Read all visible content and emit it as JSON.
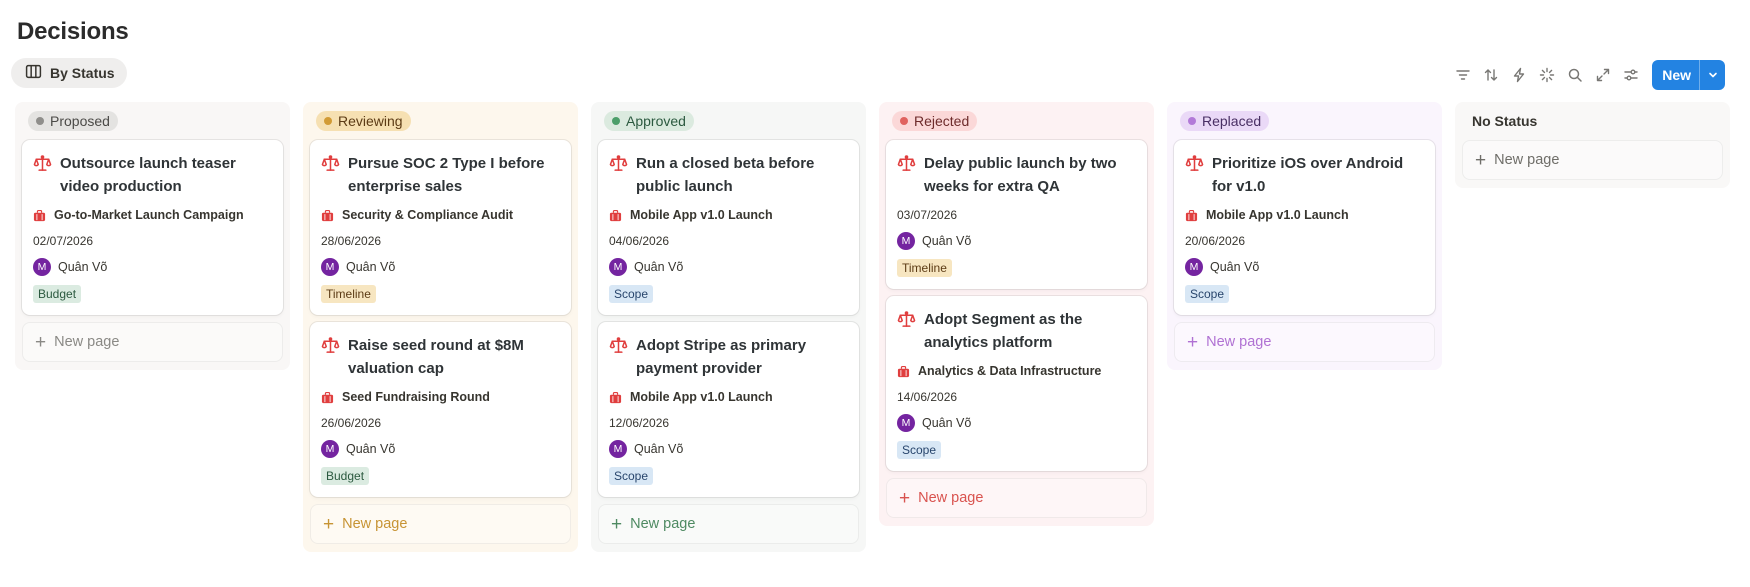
{
  "page": {
    "title": "Decisions"
  },
  "view": {
    "label": "By Status",
    "icon": "board-columns-icon"
  },
  "toolbar": {
    "icons": [
      "filter-icon",
      "sort-icon",
      "automation-lightning-icon",
      "ai-sparkle-icon",
      "search-icon",
      "expand-icon",
      "settings-sliders-icon"
    ],
    "new_label": "New"
  },
  "colors": {
    "accent": "#2383e2",
    "avatar": "#7424a0",
    "decision_icon": "#e03e3e"
  },
  "columns": [
    {
      "key": "proposed",
      "label": "Proposed",
      "bg": "#f9f7f6",
      "pill_bg": "#e4e3e1",
      "pill_text": "#4b4a47",
      "dot": "#8f8e8b",
      "new_page_color": "#8a8985",
      "new_page_label": "New page",
      "cards": [
        {
          "title": "Outsource launch teaser video production",
          "project": "Go-to-Market Launch Campaign",
          "date": "02/07/2026",
          "person": "Quân Võ",
          "avatar": "M",
          "tag": "Budget",
          "tag_bg": "#dbebe1",
          "tag_color": "#2b593f"
        }
      ]
    },
    {
      "key": "reviewing",
      "label": "Reviewing",
      "bg": "#fdf7ed",
      "pill_bg": "#f6e0b2",
      "pill_text": "#5c3b15",
      "dot": "#d29b35",
      "new_page_color": "#c79434",
      "new_page_label": "New page",
      "cards": [
        {
          "title": "Pursue SOC 2 Type I before enterprise sales",
          "project": "Security & Compliance Audit",
          "date": "28/06/2026",
          "person": "Quân Võ",
          "avatar": "M",
          "tag": "Timeline",
          "tag_bg": "#f7e6c1",
          "tag_color": "#5c3b15"
        },
        {
          "title": "Raise seed round at $8M valuation cap",
          "project": "Seed Fundraising Round",
          "date": "26/06/2026",
          "person": "Quân Võ",
          "avatar": "M",
          "tag": "Budget",
          "tag_bg": "#dbebe1",
          "tag_color": "#2b593f"
        }
      ]
    },
    {
      "key": "approved",
      "label": "Approved",
      "bg": "#f6f7f6",
      "pill_bg": "#dbeadf",
      "pill_text": "#2b593f",
      "dot": "#4b9e69",
      "new_page_color": "#4e8a62",
      "new_page_label": "New page",
      "cards": [
        {
          "title": "Run a closed beta before public launch",
          "project": "Mobile App v1.0 Launch",
          "date": "04/06/2026",
          "person": "Quân Võ",
          "avatar": "M",
          "tag": "Scope",
          "tag_bg": "#d8e7f5",
          "tag_color": "#28456c"
        },
        {
          "title": "Adopt Stripe as primary payment provider",
          "project": "Mobile App v1.0 Launch",
          "date": "12/06/2026",
          "person": "Quân Võ",
          "avatar": "M",
          "tag": "Scope",
          "tag_bg": "#d8e7f5",
          "tag_color": "#28456c"
        }
      ]
    },
    {
      "key": "rejected",
      "label": "Rejected",
      "bg": "#fdf2f3",
      "pill_bg": "#fbd8d8",
      "pill_text": "#6e2b2b",
      "dot": "#e0625f",
      "new_page_color": "#d9534f",
      "new_page_label": "New page",
      "cards": [
        {
          "title": "Delay public launch by two weeks for extra QA",
          "project": "",
          "date": "03/07/2026",
          "person": "Quân Võ",
          "avatar": "M",
          "tag": "Timeline",
          "tag_bg": "#f7e6c1",
          "tag_color": "#5c3b15"
        },
        {
          "title": "Adopt Segment as the analytics platform",
          "project": "Analytics & Data Infrastructure",
          "date": "14/06/2026",
          "person": "Quân Võ",
          "avatar": "M",
          "tag": "Scope",
          "tag_bg": "#d8e7f5",
          "tag_color": "#28456c"
        }
      ]
    },
    {
      "key": "replaced",
      "label": "Replaced",
      "bg": "#faf5fd",
      "pill_bg": "#ead9f7",
      "pill_text": "#492f64",
      "dot": "#b27ad8",
      "new_page_color": "#b071d3",
      "new_page_label": "New page",
      "cards": [
        {
          "title": "Prioritize iOS over Android for v1.0",
          "project": "Mobile App v1.0 Launch",
          "date": "20/06/2026",
          "person": "Quân Võ",
          "avatar": "M",
          "tag": "Scope",
          "tag_bg": "#d8e7f5",
          "tag_color": "#28456c"
        }
      ]
    },
    {
      "key": "no_status",
      "label": "No Status",
      "bg": "#f9f8f7",
      "pill_bg": "",
      "pill_text": "#37352f",
      "dot": "",
      "new_page_color": "#6f6e69",
      "new_page_label": "New page",
      "cards": []
    }
  ]
}
